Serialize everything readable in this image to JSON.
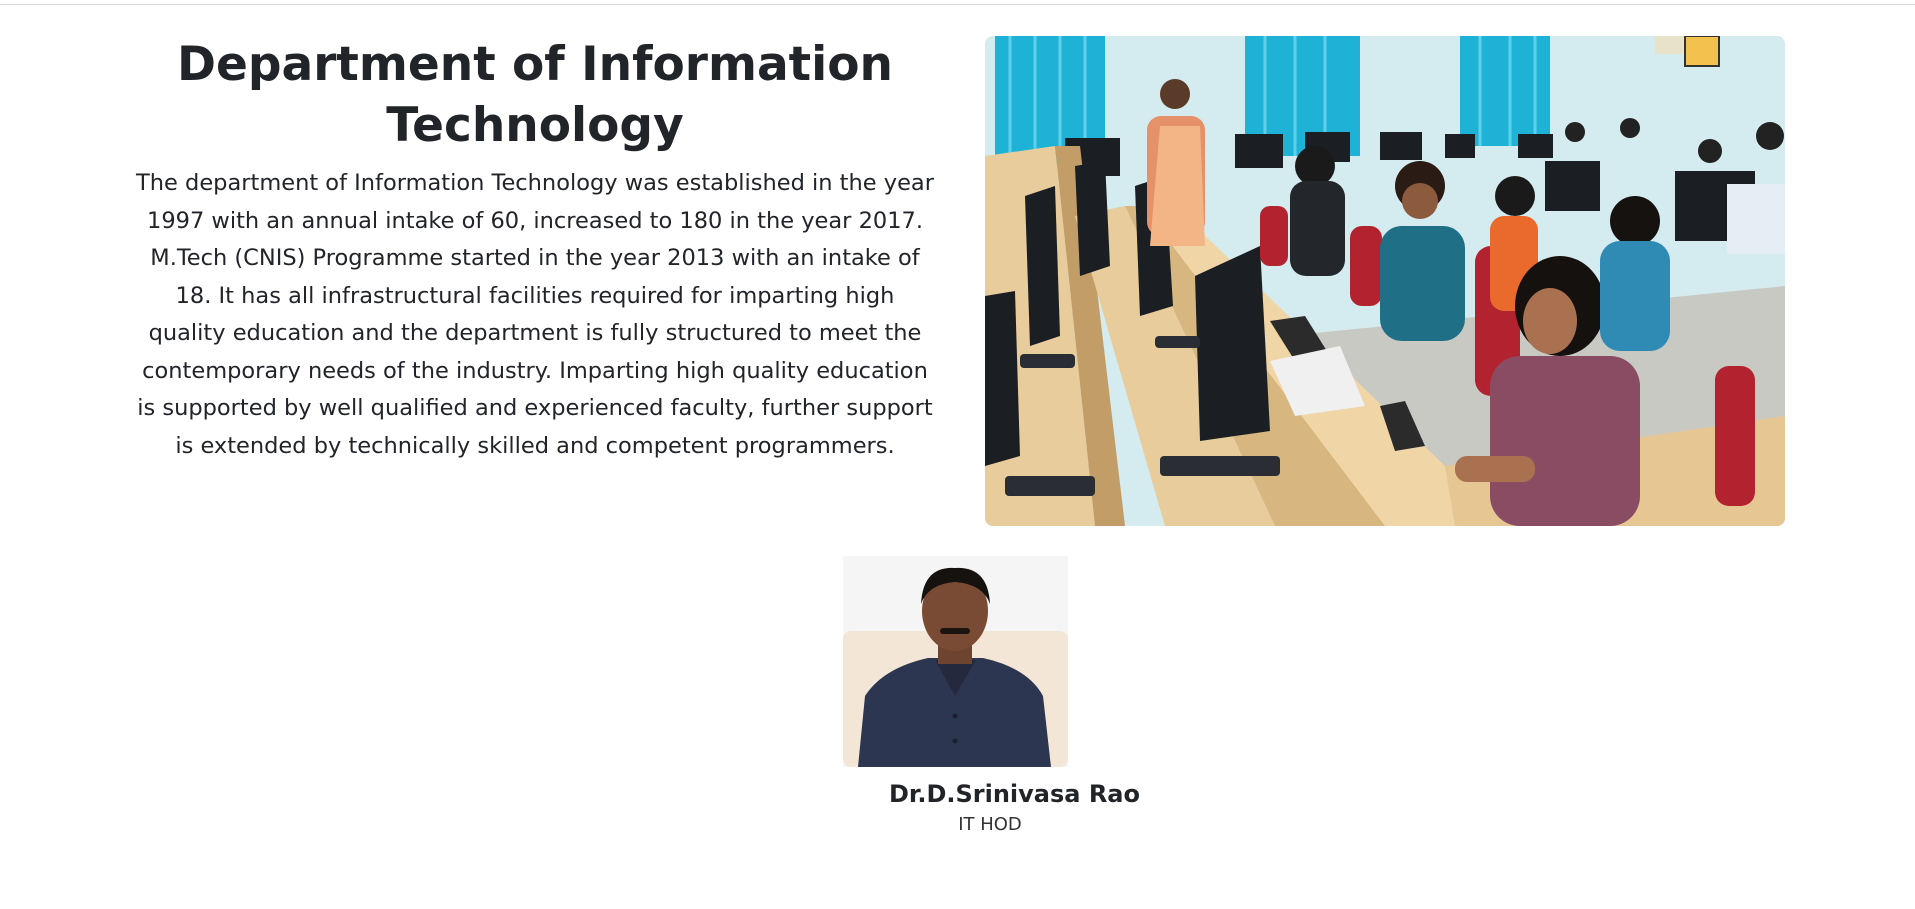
{
  "department": {
    "title": "Department of Information Technology",
    "description": "The department of Information Technology was established in the year 1997 with an annual intake of 60, increased to 180 in the year 2017. M.Tech (CNIS) Programme started in the year 2013 with an intake of 18. It has all infrastructural facilities required for imparting high quality education and the department is fully structured to meet the contemporary needs of the industry. Imparting high quality education is supported by well qualified and experienced faculty, further support is extended by technically skilled and competent programmers."
  },
  "hod": {
    "name": "Dr.D.Srinivasa Rao",
    "role": "IT HOD"
  },
  "colors": {
    "text": "#212529",
    "curtain": "#1eb3d6",
    "desk": "#e8cc9c",
    "chair": "#b3222f",
    "monitor": "#1b1e23"
  }
}
